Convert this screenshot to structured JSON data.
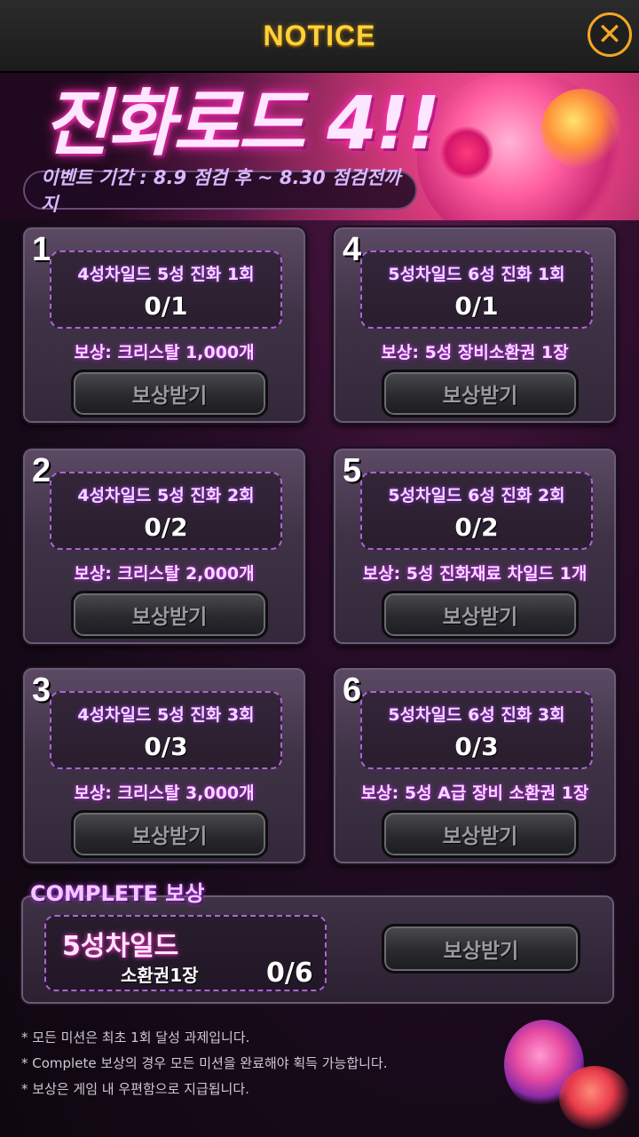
{
  "header": {
    "title": "NOTICE",
    "close_icon": "close-icon"
  },
  "banner": {
    "headline": "진화로드 4!!",
    "period": "이벤트 기간 : 8.9 점검 후 ~ 8.30 점검전까지"
  },
  "missions": [
    {
      "number": "1",
      "mission": "4성차일드 5성 진화 1회",
      "progress": "0/1",
      "reward": "보상: 크리스탈 1,000개",
      "button": "보상받기"
    },
    {
      "number": "4",
      "mission": "5성차일드 6성 진화 1회",
      "progress": "0/1",
      "reward": "보상: 5성 장비소환권 1장",
      "button": "보상받기"
    },
    {
      "number": "2",
      "mission": "4성차일드 5성 진화 2회",
      "progress": "0/2",
      "reward": "보상: 크리스탈 2,000개",
      "button": "보상받기"
    },
    {
      "number": "5",
      "mission": "5성차일드 6성 진화 2회",
      "progress": "0/2",
      "reward": "보상: 5성 진화재료 차일드 1개",
      "button": "보상받기"
    },
    {
      "number": "3",
      "mission": "4성차일드 5성 진화 3회",
      "progress": "0/3",
      "reward": "보상: 크리스탈 3,000개",
      "button": "보상받기"
    },
    {
      "number": "6",
      "mission": "5성차일드 6성 진화 3회",
      "progress": "0/3",
      "reward": "보상: 5성 A급 장비 소환권 1장",
      "button": "보상받기"
    }
  ],
  "complete": {
    "title": "COMPLETE 보상",
    "reward_main": "5성차일드",
    "reward_sub": "소환권1장",
    "progress": "0/6",
    "button": "보상받기"
  },
  "notes": [
    "* 모든 미션은 최초 1회 달성 과제입니다.",
    "* Complete 보상의 경우 모든 미션을 완료해야 획득 가능합니다.",
    "* 보상은 게임 내 우편함으로 지급됩니다."
  ],
  "colors": {
    "accent": "#f5a623",
    "title": "#ffd23a",
    "neon": "#b063d8"
  }
}
